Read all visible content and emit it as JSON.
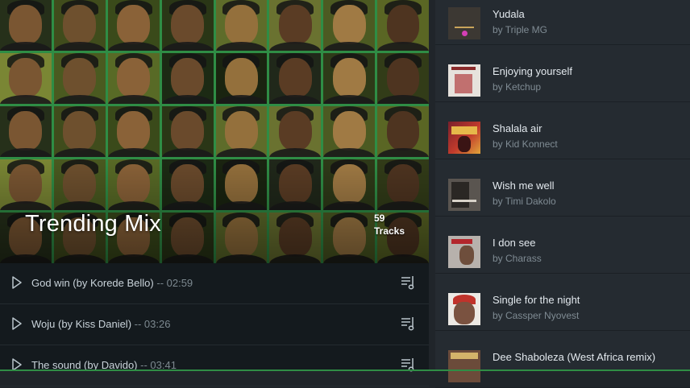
{
  "mix": {
    "title": "Trending Mix",
    "track_count": "59",
    "track_count_label": "Tracks"
  },
  "tracks": [
    {
      "title": "God win (by Korede Bello)",
      "duration": " -- 02:59"
    },
    {
      "title": "Woju (by Kiss Daniel)",
      "duration": " -- 03:26"
    },
    {
      "title": "The sound (by Davido)",
      "duration": " -- 03:41"
    }
  ],
  "songs": [
    {
      "title": "Yudala",
      "artist": "by Triple MG"
    },
    {
      "title": "Enjoying yourself",
      "artist": "by Ketchup"
    },
    {
      "title": "Shalala air",
      "artist": "by Kid Konnect"
    },
    {
      "title": "Wish me well",
      "artist": "by Timi Dakolo"
    },
    {
      "title": "I don see",
      "artist": "by Charass"
    },
    {
      "title": "Single for the night",
      "artist": "by Cassper Nyovest"
    },
    {
      "title": "Dee Shaboleza (West Africa remix)",
      "artist": ""
    }
  ],
  "colors": {
    "accent": "#2f8d45",
    "panel_left": "#141a1e",
    "panel_right": "#252b31"
  }
}
